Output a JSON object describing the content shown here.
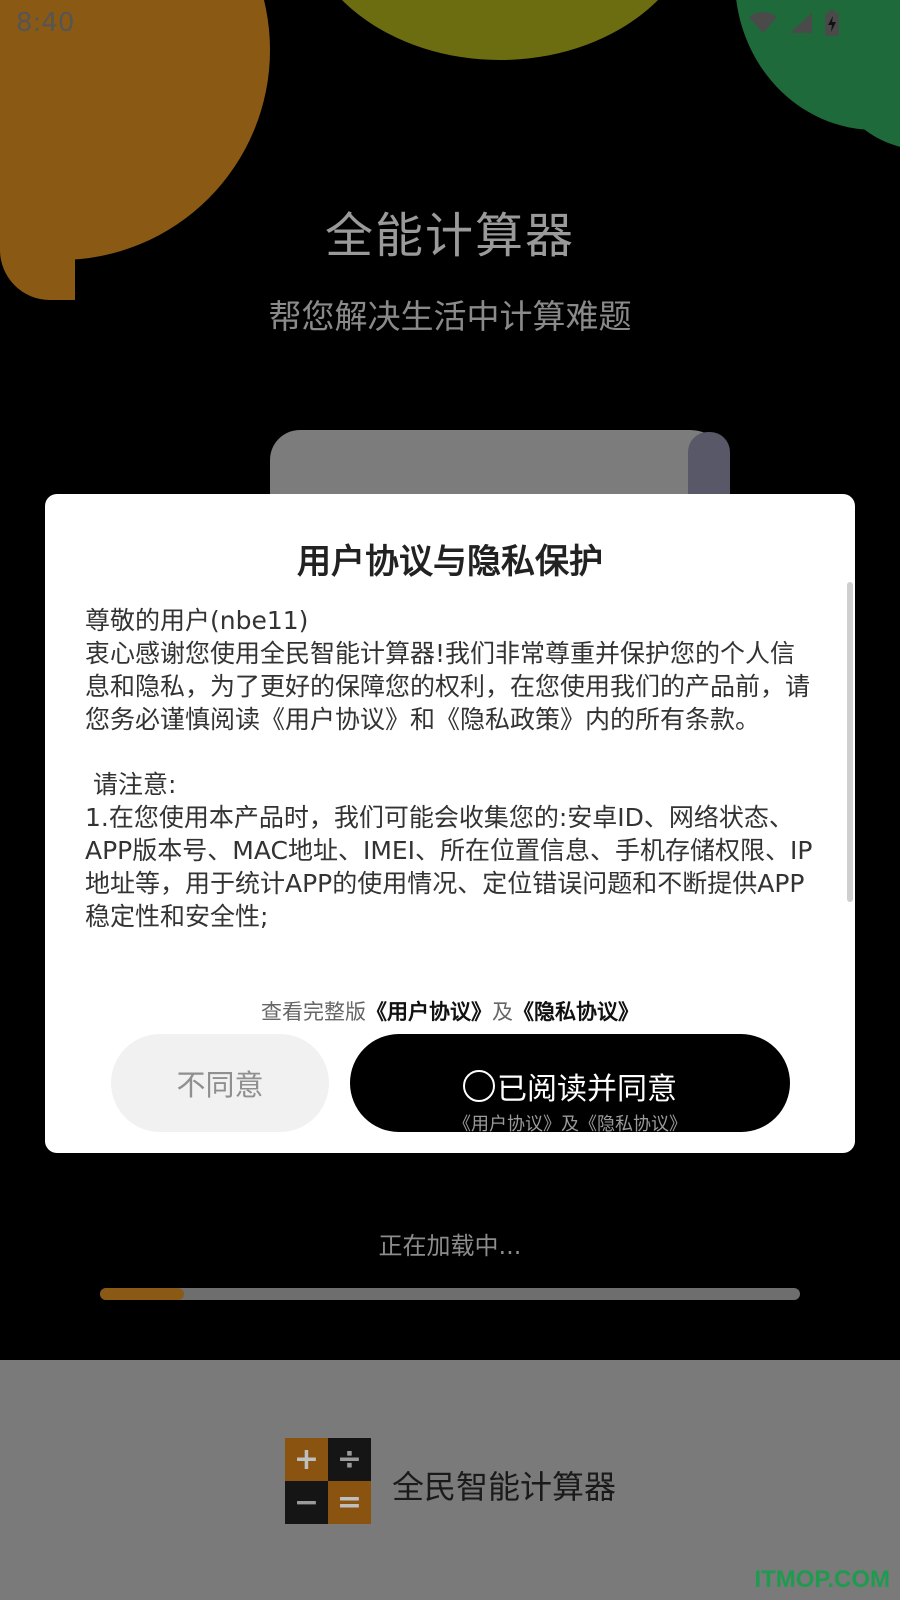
{
  "status_bar": {
    "time": "8:40",
    "icons": [
      "wifi-icon",
      "signal-icon",
      "battery-charging-icon"
    ]
  },
  "splash": {
    "title": "全能计算器",
    "subtitle": "帮您解决生活中计算难题",
    "loading_text": "正在加载中...",
    "progress": 0.12
  },
  "dialog": {
    "title": "用户协议与隐私保护",
    "greeting": "尊敬的用户(nbe11)",
    "intro": "衷心感谢您使用全民智能计算器!我们非常尊重并保护您的个人信息和隐私，为了更好的保障您的权利，在您使用我们的产品前，请您务必谨慎阅读《用户协议》和《隐私政策》内的所有条款。",
    "notice_heading": " 请注意:",
    "notice_1": "1.在您使用本产品时，我们可能会收集您的:安卓ID、网络状态、APP版本号、MAC地址、IMEI、所在位置信息、手机存储权限、IP地址等，用于统计APP的使用情况、定位错误问题和不断提供APP稳定性和安全性;",
    "links_prefix": "查看完整版",
    "link_user_agreement": "《用户协议》",
    "links_and": "及",
    "link_privacy_agreement": "《隐私协议》",
    "disagree_label": "不同意",
    "agree_label": "已阅读并同意",
    "agree_sublabel": "《用户协议》及《隐私协议》"
  },
  "footer": {
    "app_name": "全民智能计算器",
    "logo_symbols": [
      "+",
      "÷",
      "−",
      "="
    ],
    "watermark": "ITMOP.COM"
  },
  "colors": {
    "accent_orange": "#8a5a14",
    "dialog_bg": "#ffffff",
    "agree_button": "#000000"
  }
}
